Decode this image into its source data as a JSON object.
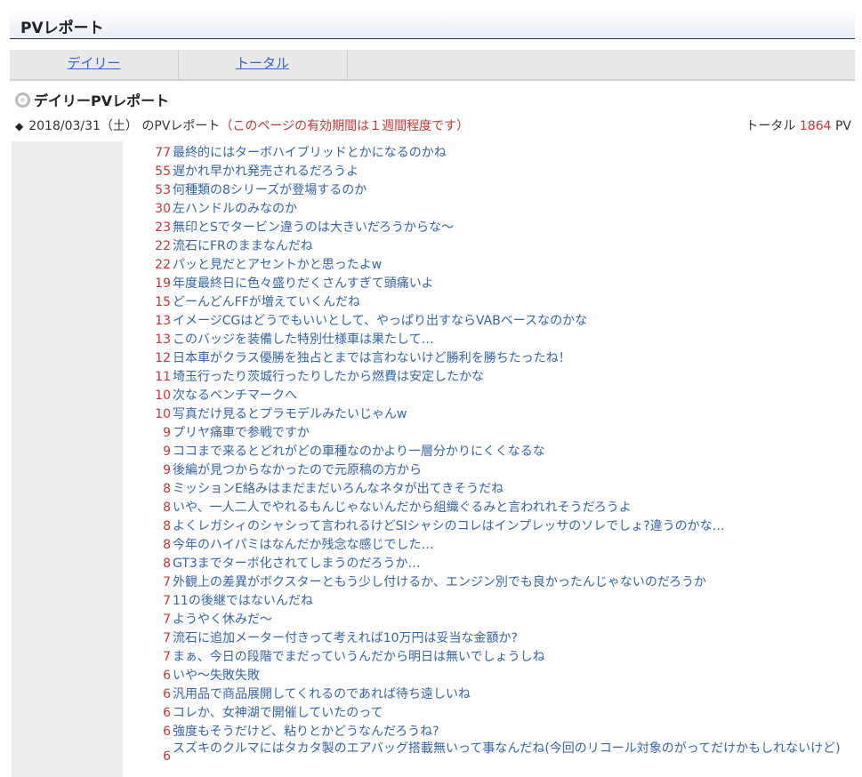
{
  "header": {
    "title": "PVレポート"
  },
  "tabs": [
    {
      "label": "デイリー"
    },
    {
      "label": "トータル"
    }
  ],
  "section": {
    "title": "デイリーPVレポート"
  },
  "report": {
    "date_prefix": "2018/03/31（土） のPVレポート",
    "note": "（このページの有効期間は１週間程度です）",
    "total_label": "トータル ",
    "total_value": "1864",
    "total_unit": " PV"
  },
  "entries": [
    {
      "count": "77",
      "title": "最終的にはターボハイブリッドとかになるのかね"
    },
    {
      "count": "55",
      "title": "遅かれ早かれ発売されるだろうよ"
    },
    {
      "count": "53",
      "title": "何種類の8シリーズが登場するのか"
    },
    {
      "count": "30",
      "title": "左ハンドルのみなのか"
    },
    {
      "count": "23",
      "title": "無印とSでタービン違うのは大きいだろうからな〜"
    },
    {
      "count": "22",
      "title": "流石にFRのままなんだね"
    },
    {
      "count": "22",
      "title": "パッと見だとアセントかと思ったよw"
    },
    {
      "count": "19",
      "title": "年度最終日に色々盛りだくさんすぎて頭痛いよ"
    },
    {
      "count": "15",
      "title": "どーんどんFFが増えていくんだね"
    },
    {
      "count": "13",
      "title": "イメージCGはどうでもいいとして、やっぱり出すならVABベースなのかな"
    },
    {
      "count": "13",
      "title": "このバッジを装備した特別仕様車は果たして…"
    },
    {
      "count": "12",
      "title": "日本車がクラス優勝を独占とまでは言わないけど勝利を勝ちたったね！"
    },
    {
      "count": "11",
      "title": "埼玉行ったり茨城行ったりしたから燃費は安定したかな"
    },
    {
      "count": "10",
      "title": "次なるベンチマークへ"
    },
    {
      "count": "10",
      "title": "写真だけ見るとプラモデルみたいじゃんw"
    },
    {
      "count": "9",
      "title": "プリヤ痛車で参戦ですか"
    },
    {
      "count": "9",
      "title": "ココまで来るとどれがどの車種なのかより一層分かりにくくなるな"
    },
    {
      "count": "9",
      "title": "後編が見つからなかったので元原稿の方から"
    },
    {
      "count": "8",
      "title": "ミッションE絡みはまだまだいろんなネタが出てきそうだね"
    },
    {
      "count": "8",
      "title": "いや、一人二人でやれるもんじゃないんだから組織ぐるみと言われれそうだろうよ"
    },
    {
      "count": "8",
      "title": "よくレガシィのシャシって言われるけどSIシャシのコレはインプレッサのソレでしょ?違うのかな…"
    },
    {
      "count": "8",
      "title": "今年のハイパミはなんだか残念な感じでした…"
    },
    {
      "count": "8",
      "title": "GT3までターボ化されてしまうのだろうか…"
    },
    {
      "count": "7",
      "title": "外観上の差異がボクスターともう少し付けるか、エンジン別でも良かったんじゃないのだろうか"
    },
    {
      "count": "7",
      "title": "11の後継ではないんだね"
    },
    {
      "count": "7",
      "title": "ようやく休みだ〜"
    },
    {
      "count": "7",
      "title": "流石に追加メーター付きって考えれば10万円は妥当な金額か?"
    },
    {
      "count": "7",
      "title": "まぁ、今日の段階でまだっていうんだから明日は無いでしょうしね"
    },
    {
      "count": "6",
      "title": "いや〜失敗失敗"
    },
    {
      "count": "6",
      "title": "汎用品で商品展開してくれるのであれば待ち遠しいね"
    },
    {
      "count": "6",
      "title": "コレか、女神湖で開催していたのって"
    },
    {
      "count": "6",
      "title": "強度もそうだけど、粘りとかどうなんだろうね?"
    },
    {
      "count": "6",
      "title": "スズキのクルマにはタカタ製のエアバッグ搭載無いって事なんだね(今回のリコール対象のがってだけかもしれないけど)"
    }
  ]
}
